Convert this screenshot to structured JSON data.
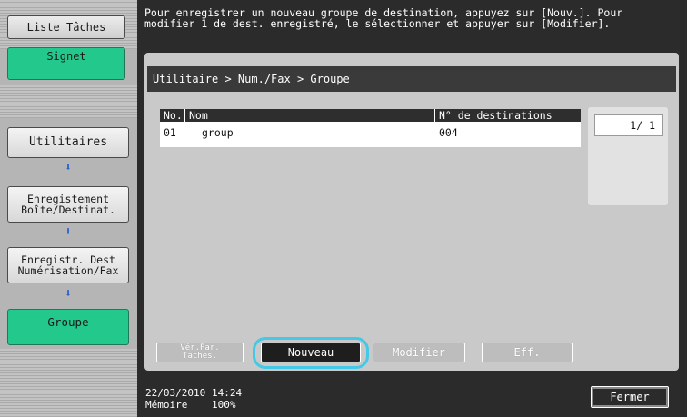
{
  "left_panel": {
    "job_list_label": "Liste Tâches",
    "bookmark_label": "Signet",
    "nav": [
      {
        "label": "Utilitaires"
      },
      {
        "label": "Enregistement\nBoîte/Destinat."
      },
      {
        "label": "Enregistr. Dest\nNumérisation/Fax"
      },
      {
        "label": "Groupe"
      }
    ],
    "arrow_glyph": "⬇"
  },
  "message": "Pour enregistrer un nouveau groupe de destination, appuyez sur [Nouv.]. Pour\nmodifier 1 de dest. enregistré, le sélectionner et appuyer sur [Modifier].",
  "breadcrumb": "Utilitaire > Num./Fax > Groupe",
  "table": {
    "headers": [
      "No.",
      "Nom",
      "N° de destinations"
    ],
    "rows": [
      {
        "no": "01",
        "name": "group",
        "count": "004"
      }
    ]
  },
  "pager": {
    "text": "1/  1"
  },
  "buttons": {
    "ver_par_taches": "Vér.Par.\nTâches.",
    "nouveau": "Nouveau",
    "modifier": "Modifier",
    "eff": "Eff."
  },
  "status": {
    "date": "22/03/2010",
    "time": "14:24",
    "memory_label": "Mémoire",
    "memory_value": "100%"
  },
  "close_label": "Fermer",
  "colors": {
    "accent_green": "#22c88c",
    "highlight_cyan": "#43c9e6",
    "arrow_blue": "#2f63c8"
  }
}
